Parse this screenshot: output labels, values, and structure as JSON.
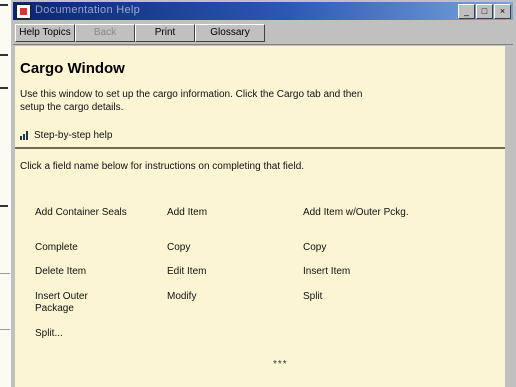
{
  "window": {
    "title": "Documentation Help",
    "buttons": [
      "_",
      "□",
      "×"
    ]
  },
  "toolbar": {
    "help_topics": "Help Topics",
    "back": "Back",
    "print": "Print",
    "glossary": "Glossary"
  },
  "page": {
    "heading": "Cargo Window",
    "intro_line1": "Use this window to set up the cargo information. Click the Cargo tab and then",
    "intro_line2": "setup the cargo details.",
    "step_link": "Step-by-step help",
    "subtitle": "Click a field name below for instructions on completing that field."
  },
  "fields": {
    "col1": [
      "Add Container Seals",
      "Complete",
      "Delete Item",
      "Insert Outer Package",
      "Split..."
    ],
    "col2": [
      "Add Item",
      "Copy",
      "Edit Item",
      "Modify"
    ],
    "col3": [
      "Add Item w/Outer Pckg.",
      "Copy",
      "Insert Item",
      "Split"
    ]
  },
  "more_indicator": "***"
}
